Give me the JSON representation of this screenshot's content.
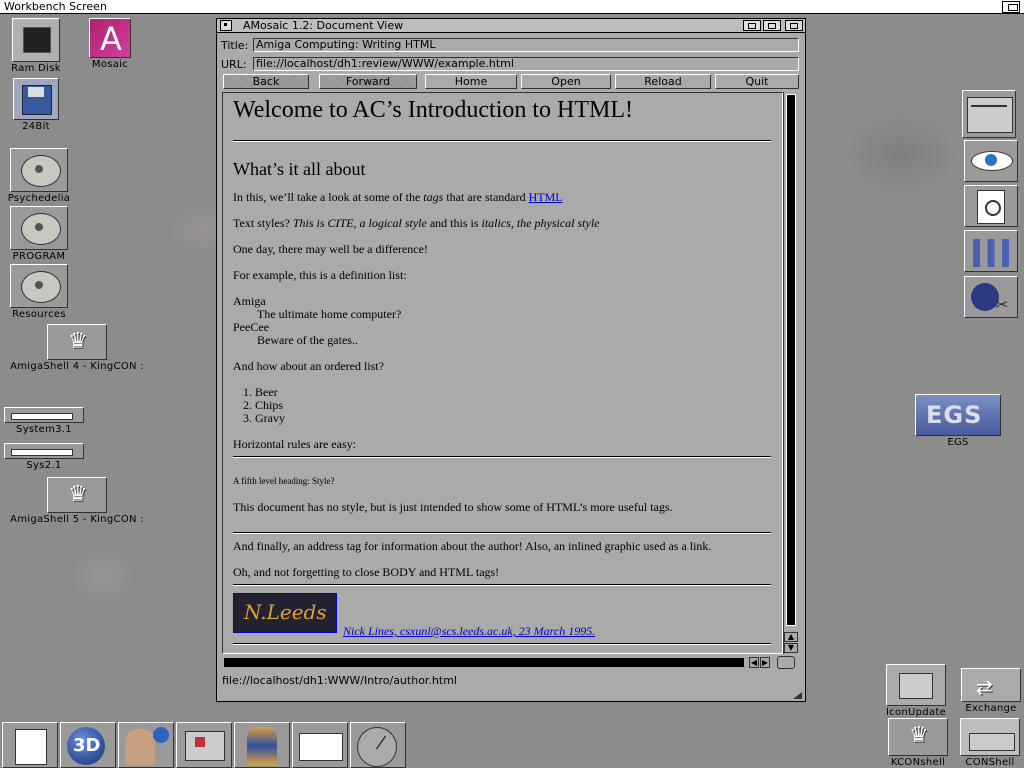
{
  "screen": {
    "title": "Workbench Screen"
  },
  "desktop_icons": {
    "ram_disk": "Ram Disk",
    "mosaic": "Mosaic",
    "bit24": "24Bit",
    "psychedelia": "Psychedelia",
    "program": "PROGRAM",
    "resources": "Resources",
    "amigashell4": "AmigaShell 4 - KingCON :",
    "system31": "System3.1",
    "sys21": "Sys2.1",
    "amigashell5": "AmigaShell 5 - KingCON :",
    "egs": "EGS",
    "egs_badge": "EGS",
    "iconupdate": "IconUpdate",
    "exchange": "Exchange",
    "konshell": "KCONshell",
    "conshell": "CONShell"
  },
  "window": {
    "title": "AMosaic 1.2: Document View",
    "title_label": "Title:",
    "title_value": "Amiga Computing: Writing HTML",
    "url_label": "URL:",
    "url_value": "file://localhost/dh1:review/WWW/example.html",
    "buttons": {
      "back": "Back",
      "forward": "Forward",
      "home": "Home",
      "open": "Open",
      "reload": "Reload",
      "quit": "Quit"
    },
    "status_url": "file://localhost/dh1:WWW/Intro/author.html"
  },
  "doc": {
    "h1": "Welcome to AC’s Introduction to HTML!",
    "h3": "What’s it all about",
    "p1_a": "In this, we’ll take a look at some of the ",
    "p1_tags": "tags",
    "p1_b": " that are standard ",
    "p1_link": "HTML",
    "p2_a": "Text styles? ",
    "p2_cite": "This is CITE, a logical style",
    "p2_b": " and this is ",
    "p2_italic": "italics, the physical style",
    "p3": "One day, there may well be a difference!",
    "p4": "For example, this is a definition list:",
    "dl": [
      {
        "term": "Amiga",
        "def": "The ultimate home computer?"
      },
      {
        "term": "PeeCee",
        "def": "Beware of the gates.."
      }
    ],
    "p5": "And how about an ordered list?",
    "ol": [
      "1. Beer",
      "2. Chips",
      "3. Gravy"
    ],
    "p6": "Horizontal rules are easy:",
    "h5": "A fifth level heading: Style?",
    "p7": "This document has no style, but is just intended to show some of HTML’s more useful tags.",
    "p8": "And finally, an address tag for information about the author! Also, an inlined graphic used as a link.",
    "p9": "Oh, and not forgetting to close BODY and HTML tags!",
    "address": "Nick Lines, csxunl@scs.leeds.ac.uk, 23 March 1995.",
    "signature": "N.Leeds"
  }
}
